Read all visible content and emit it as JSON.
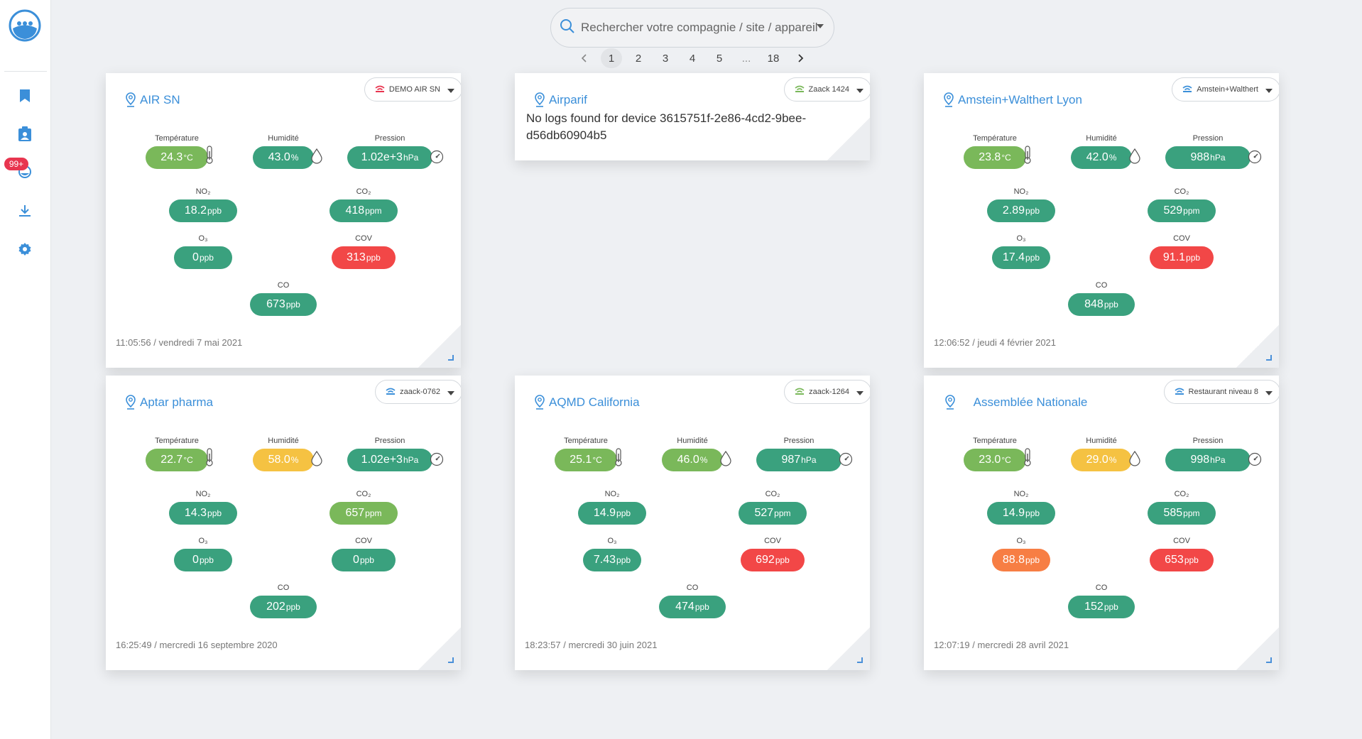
{
  "search": {
    "placeholder": "Rechercher votre compagnie / site / appareil"
  },
  "pagination": {
    "pages": [
      "1",
      "2",
      "3",
      "4",
      "5",
      "...",
      "18"
    ],
    "current": "1"
  },
  "sidebar": {
    "badge": "99+"
  },
  "labels": {
    "temp": "Température",
    "hum": "Humidité",
    "pres": "Pression",
    "no2": "NO₂",
    "co2": "CO₂",
    "o3": "O₃",
    "cov": "COV",
    "co": "CO"
  },
  "cards": [
    {
      "title": "AIR SN",
      "device": "DEMO AIR SN",
      "wifi_color": "#e8354f",
      "temp": "24.3",
      "temp_unit": "°C",
      "temp_color": "lgreen",
      "hum": "43.0",
      "hum_unit": "%",
      "hum_color": "green",
      "pres": "1.02e+3",
      "pres_unit": "hPa",
      "pres_color": "green",
      "no2": "18.2",
      "no2_unit": "ppb",
      "no2_color": "green",
      "co2": "418",
      "co2_unit": "ppm",
      "co2_color": "green",
      "o3": "0",
      "o3_unit": "ppb",
      "o3_color": "green",
      "cov": "313",
      "cov_unit": "ppb",
      "cov_color": "red",
      "co": "673",
      "co_unit": "ppb",
      "co_color": "green",
      "timestamp": "11:05:56 / vendredi 7 mai 2021"
    },
    {
      "title": "Airparif",
      "device": "Zaack 1424",
      "wifi_color": "#7ab85a",
      "message": "No logs found for device 3615751f-2e86-4cd2-9bee-d56db60904b5"
    },
    {
      "title": "Amstein+Walthert Lyon",
      "device": "Amstein+Walthert",
      "wifi_color": "#3b8fd9",
      "temp": "23.8",
      "temp_unit": "°C",
      "temp_color": "lgreen",
      "hum": "42.0",
      "hum_unit": "%",
      "hum_color": "green",
      "pres": "988",
      "pres_unit": "hPa",
      "pres_color": "green",
      "no2": "2.89",
      "no2_unit": "ppb",
      "no2_color": "green",
      "co2": "529",
      "co2_unit": "ppm",
      "co2_color": "green",
      "o3": "17.4",
      "o3_unit": "ppb",
      "o3_color": "green",
      "cov": "91.1",
      "cov_unit": "ppb",
      "cov_color": "red",
      "co": "848",
      "co_unit": "ppb",
      "co_color": "green",
      "timestamp": "12:06:52 / jeudi 4 février 2021"
    },
    {
      "title": "Aptar pharma",
      "device": "zaack-0762",
      "wifi_color": "#3b8fd9",
      "temp": "22.7",
      "temp_unit": "°C",
      "temp_color": "lgreen",
      "hum": "58.0",
      "hum_unit": "%",
      "hum_color": "yellow",
      "pres": "1.02e+3",
      "pres_unit": "hPa",
      "pres_color": "green",
      "no2": "14.3",
      "no2_unit": "ppb",
      "no2_color": "green",
      "co2": "657",
      "co2_unit": "ppm",
      "co2_color": "lgreen",
      "o3": "0",
      "o3_unit": "ppb",
      "o3_color": "green",
      "cov": "0",
      "cov_unit": "ppb",
      "cov_color": "green",
      "co": "202",
      "co_unit": "ppb",
      "co_color": "green",
      "timestamp": "16:25:49 / mercredi 16 septembre 2020"
    },
    {
      "title": "AQMD California",
      "device": "zaack-1264",
      "wifi_color": "#7ab85a",
      "temp": "25.1",
      "temp_unit": "°C",
      "temp_color": "lgreen",
      "hum": "46.0",
      "hum_unit": "%",
      "hum_color": "lgreen",
      "pres": "987",
      "pres_unit": "hPa",
      "pres_color": "green",
      "no2": "14.9",
      "no2_unit": "ppb",
      "no2_color": "green",
      "co2": "527",
      "co2_unit": "ppm",
      "co2_color": "green",
      "o3": "7.43",
      "o3_unit": "ppb",
      "o3_color": "green",
      "cov": "692",
      "cov_unit": "ppb",
      "cov_color": "red",
      "co": "474",
      "co_unit": "ppb",
      "co_color": "green",
      "timestamp": "18:23:57 / mercredi 30 juin 2021"
    },
    {
      "title": "Assemblée Nationale",
      "device": "Restaurant niveau 8",
      "wifi_color": "#3b8fd9",
      "temp": "23.0",
      "temp_unit": "°C",
      "temp_color": "lgreen",
      "hum": "29.0",
      "hum_unit": "%",
      "hum_color": "yellow",
      "pres": "998",
      "pres_unit": "hPa",
      "pres_color": "green",
      "no2": "14.9",
      "no2_unit": "ppb",
      "no2_color": "green",
      "co2": "585",
      "co2_unit": "ppm",
      "co2_color": "green",
      "o3": "88.8",
      "o3_unit": "ppb",
      "o3_color": "orange",
      "cov": "653",
      "cov_unit": "ppb",
      "cov_color": "red",
      "co": "152",
      "co_unit": "ppb",
      "co_color": "green",
      "timestamp": "12:07:19 / mercredi 28 avril 2021"
    }
  ]
}
